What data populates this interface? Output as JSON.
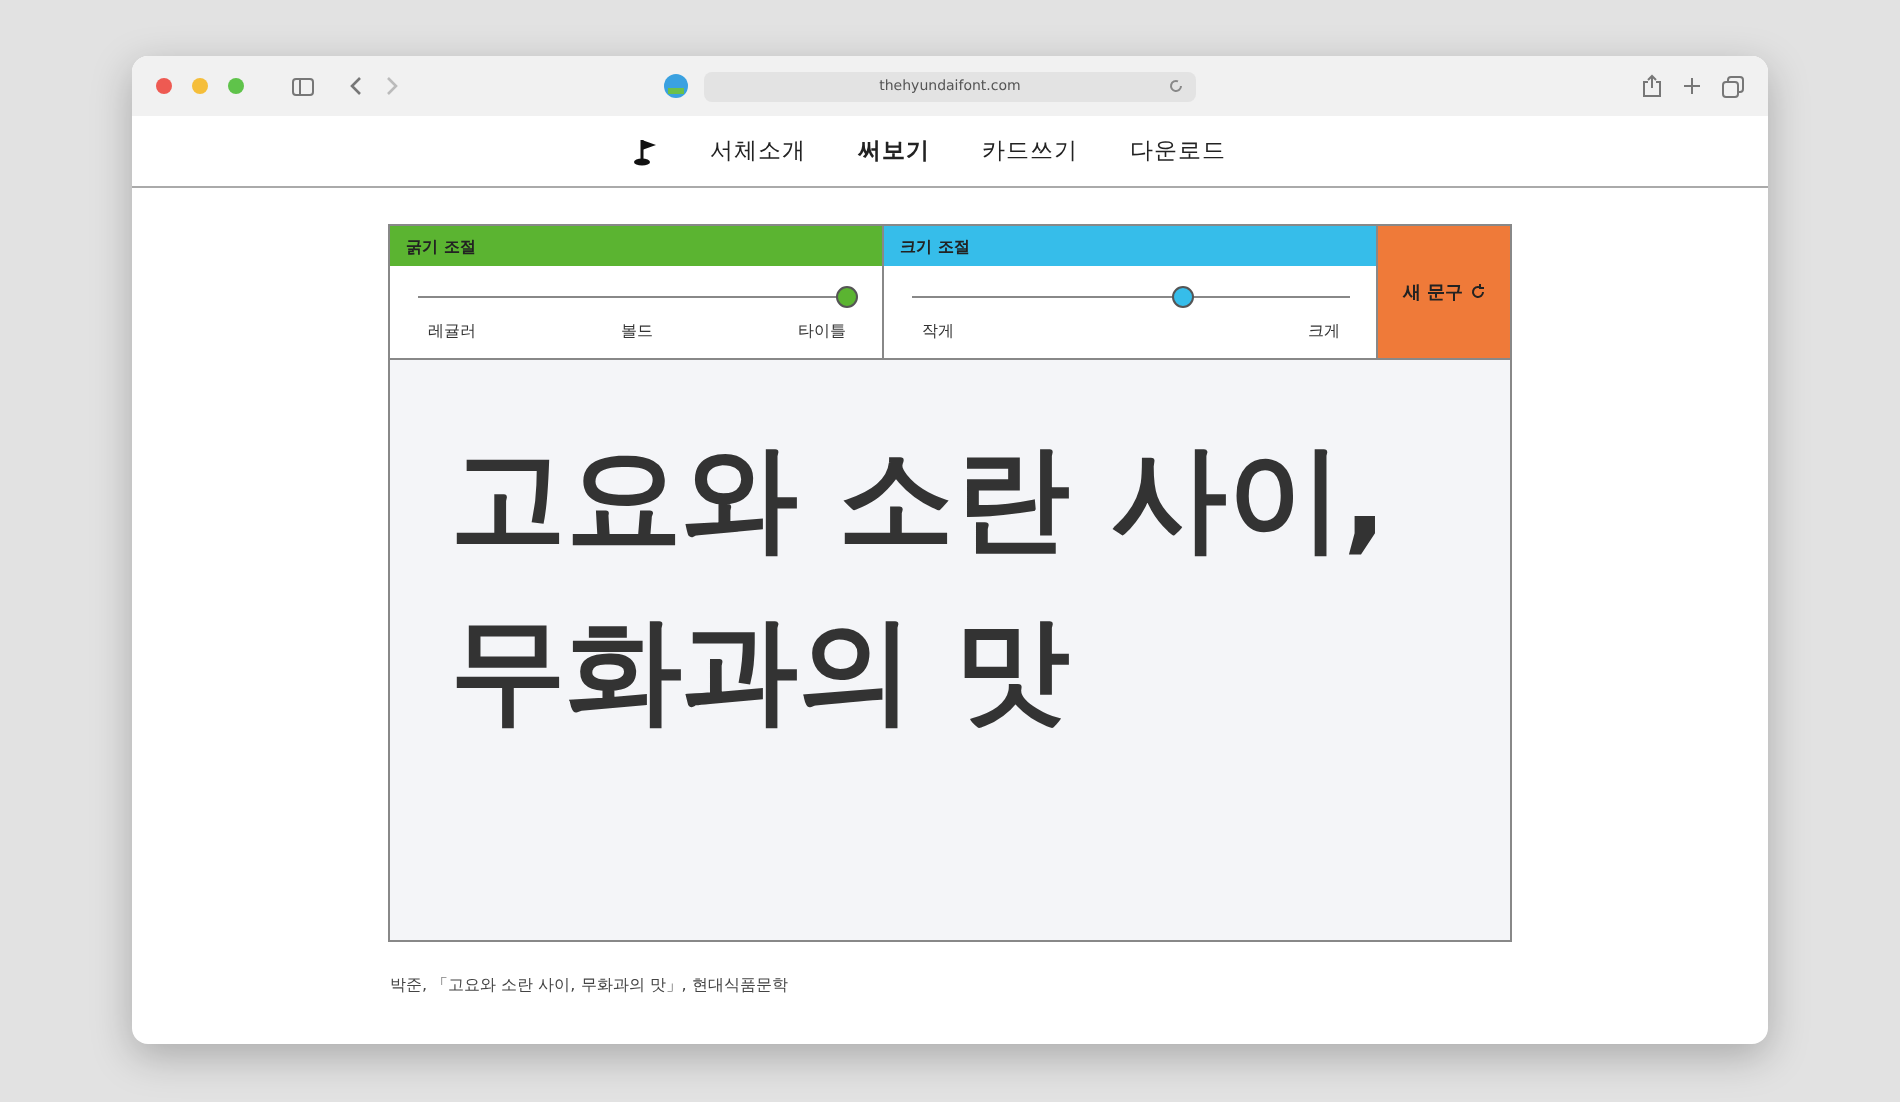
{
  "browser": {
    "url": "thehyundaifont.com"
  },
  "nav": {
    "items": [
      {
        "label": "서체소개",
        "selected": false
      },
      {
        "label": "써보기",
        "selected": true
      },
      {
        "label": "카드쓰기",
        "selected": false
      },
      {
        "label": "다운로드",
        "selected": false
      }
    ]
  },
  "controls": [
    {
      "title": "굵기 조절",
      "color": "#5bb431",
      "level": 1.0,
      "labels": [
        "레귤러",
        "볼드",
        "타이틀"
      ]
    },
    {
      "title": "크기 조절",
      "color": "#36bdea",
      "level": 0.62,
      "labels": [
        "작게",
        "크게"
      ]
    }
  ],
  "new_phrase_button": {
    "label": "새 문구"
  },
  "preview": {
    "lines": [
      "고요와 소란 사이,",
      "무화과의 맛"
    ]
  },
  "caption": "박준, 「고요와 소란 사이, 무화과의 맛」, 현대식품문학"
}
